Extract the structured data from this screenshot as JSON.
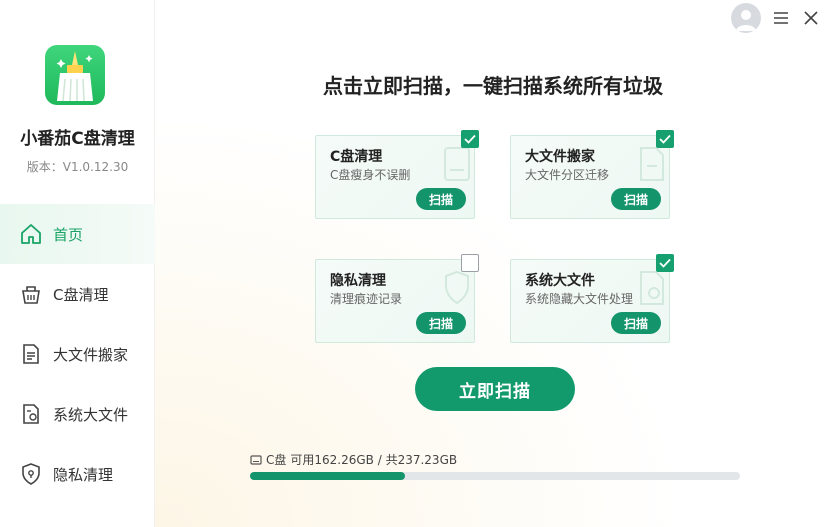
{
  "app": {
    "name": "小番茄C盘清理",
    "version": "版本：V1.0.12.30"
  },
  "nav": {
    "items": [
      {
        "label": "首页",
        "icon": "home-icon",
        "active": true
      },
      {
        "label": "C盘清理",
        "icon": "basket-icon",
        "active": false
      },
      {
        "label": "大文件搬家",
        "icon": "document-move-icon",
        "active": false
      },
      {
        "label": "系统大文件",
        "icon": "system-file-icon",
        "active": false
      },
      {
        "label": "隐私清理",
        "icon": "shield-icon",
        "active": false
      }
    ]
  },
  "topbar": {
    "avatar_icon": "user-avatar-icon",
    "menu_icon": "menu-icon",
    "close_icon": "close-icon"
  },
  "main": {
    "headline": "点击立即扫描，一键扫描系统所有垃圾",
    "cards": [
      {
        "title": "C盘清理",
        "desc": "C盘瘦身不误删",
        "button": "扫描",
        "checked": true
      },
      {
        "title": "大文件搬家",
        "desc": "大文件分区迁移",
        "button": "扫描",
        "checked": true
      },
      {
        "title": "隐私清理",
        "desc": "清理痕迹记录",
        "button": "扫描",
        "checked": false
      },
      {
        "title": "系统大文件",
        "desc": "系统隐藏大文件处理",
        "button": "扫描",
        "checked": true
      }
    ],
    "scan_button": "立即扫描"
  },
  "disk": {
    "label": "C盘",
    "usage_text": "可用162.26GB / 共237.23GB",
    "used_fraction": 0.316
  },
  "colors": {
    "accent": "#14946a",
    "active_nav_text": "#18a366"
  }
}
